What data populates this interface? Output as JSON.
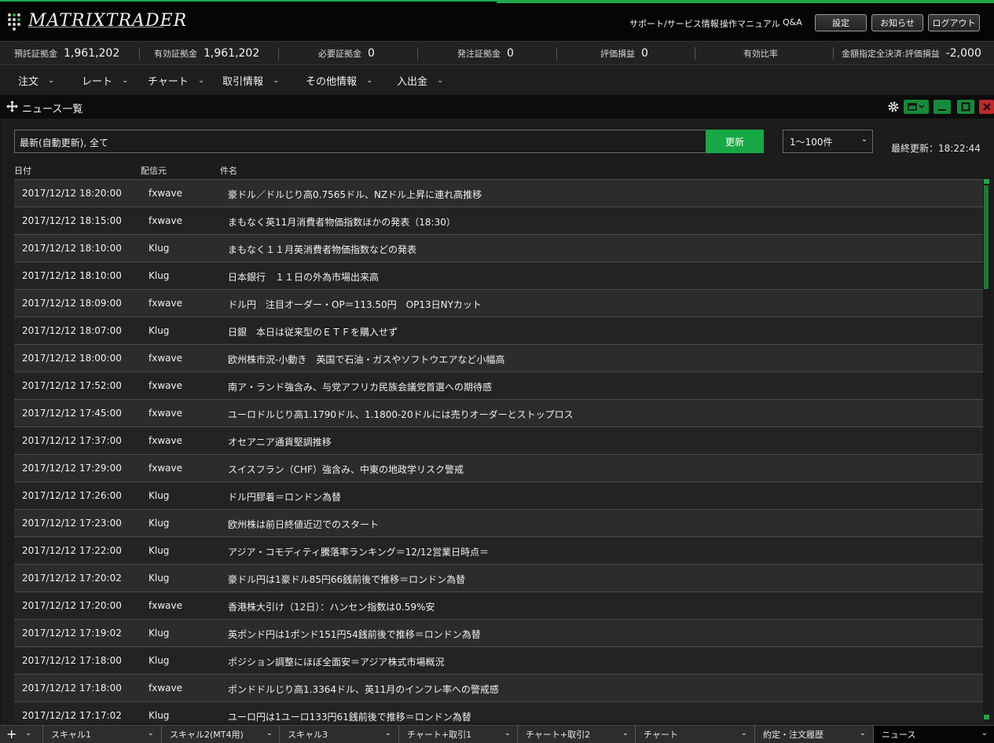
{
  "app": {
    "logo_text": "MATRIXTRADER"
  },
  "top_links": [
    "サポート/サービス情報",
    "操作マニュアル",
    "Q&A"
  ],
  "top_buttons": {
    "settings": "設定",
    "notice": "お知らせ",
    "logout": "ログアウト"
  },
  "account": [
    {
      "label": "預託証拠金",
      "value": "1,961,202"
    },
    {
      "label": "有効証拠金",
      "value": "1,961,202"
    },
    {
      "label": "必要証拠金",
      "value": "0"
    },
    {
      "label": "発注証拠金",
      "value": "0"
    },
    {
      "label": "評価損益",
      "value": "0"
    },
    {
      "label": "有効比率",
      "value": ""
    },
    {
      "label": "金額指定全決済:評価損益",
      "value": "-2,000"
    }
  ],
  "menu": [
    "注文",
    "レート",
    "チャート",
    "取引情報",
    "その他情報",
    "入出金"
  ],
  "panel": {
    "title": "ニュース一覧"
  },
  "filter": {
    "value": "最新(自動更新), 全て",
    "refresh_label": "更新",
    "count_value": "1～100件",
    "last_update": "最終更新：18:22:44"
  },
  "columns": {
    "date": "日付",
    "source": "配信元",
    "subject": "件名"
  },
  "news": [
    {
      "date": "2017/12/12 18:20:00",
      "source": "fxwave",
      "subject": "豪ドル／ドルじり高0.7565ドル、NZドル上昇に連れ高推移"
    },
    {
      "date": "2017/12/12 18:15:00",
      "source": "fxwave",
      "subject": "まもなく英11月消費者物価指数ほかの発表（18:30）"
    },
    {
      "date": "2017/12/12 18:10:00",
      "source": "Klug",
      "subject": "まもなく１１月英消費者物価指数などの発表"
    },
    {
      "date": "2017/12/12 18:10:00",
      "source": "Klug",
      "subject": "日本銀行　１１日の外為市場出来高"
    },
    {
      "date": "2017/12/12 18:09:00",
      "source": "fxwave",
      "subject": "ドル円　注目オーダー・OP＝113.50円　OP13日NYカット"
    },
    {
      "date": "2017/12/12 18:07:00",
      "source": "Klug",
      "subject": "日銀　本日は従来型のＥＴＦを購入せず"
    },
    {
      "date": "2017/12/12 18:00:00",
      "source": "fxwave",
      "subject": "欧州株市況-小動き　英国で石油・ガスやソフトウエアなど小幅高"
    },
    {
      "date": "2017/12/12 17:52:00",
      "source": "fxwave",
      "subject": "南ア・ランド強含み、与党アフリカ民族会議党首選への期待感"
    },
    {
      "date": "2017/12/12 17:45:00",
      "source": "fxwave",
      "subject": "ユーロドルじり高1.1790ドル、1.1800-20ドルには売りオーダーとストップロス"
    },
    {
      "date": "2017/12/12 17:37:00",
      "source": "fxwave",
      "subject": "オセアニア通貨堅調推移"
    },
    {
      "date": "2017/12/12 17:29:00",
      "source": "fxwave",
      "subject": "スイスフラン（CHF）強含み、中東の地政学リスク警戒"
    },
    {
      "date": "2017/12/12 17:26:00",
      "source": "Klug",
      "subject": "ドル円膠着＝ロンドン為替"
    },
    {
      "date": "2017/12/12 17:23:00",
      "source": "Klug",
      "subject": "欧州株は前日終値近辺でのスタート"
    },
    {
      "date": "2017/12/12 17:22:00",
      "source": "Klug",
      "subject": "アジア・コモディティ騰落率ランキング＝12/12営業日時点＝"
    },
    {
      "date": "2017/12/12 17:20:02",
      "source": "Klug",
      "subject": "豪ドル円は1豪ドル85円66銭前後で推移＝ロンドン為替"
    },
    {
      "date": "2017/12/12 17:20:00",
      "source": "fxwave",
      "subject": "香港株大引け（12日）：ハンセン指数は0.59%安"
    },
    {
      "date": "2017/12/12 17:19:02",
      "source": "Klug",
      "subject": "英ポンド円は1ポンド151円54銭前後で推移＝ロンドン為替"
    },
    {
      "date": "2017/12/12 17:18:00",
      "source": "Klug",
      "subject": "ポジション調整にほぼ全面安＝アジア株式市場概況"
    },
    {
      "date": "2017/12/12 17:18:00",
      "source": "fxwave",
      "subject": "ポンドドルじり高1.3364ドル、英11月のインフレ率への警戒感"
    },
    {
      "date": "2017/12/12 17:17:02",
      "source": "Klug",
      "subject": "ユーロ円は1ユーロ133円61銭前後で推移＝ロンドン為替"
    }
  ],
  "tabs": [
    "スキャル1",
    "スキャル2(MT4用)",
    "スキャル3",
    "チャート+取引1",
    "チャート+取引2",
    "チャート",
    "約定・注文履歴",
    "ニュース"
  ],
  "colors": {
    "accent": "#18a845",
    "close": "#c0282d"
  }
}
